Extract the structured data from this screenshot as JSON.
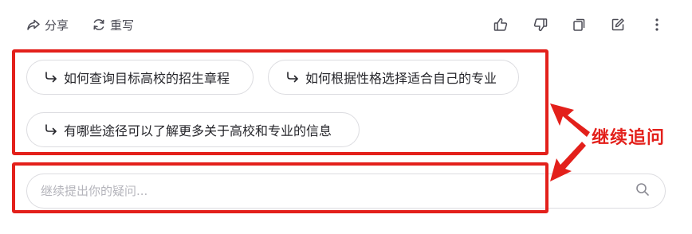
{
  "actions": {
    "share_label": "分享",
    "rewrite_label": "重写"
  },
  "toolbar_icons": [
    "thumbs-up-icon",
    "thumbs-down-icon",
    "copy-icon",
    "edit-icon",
    "more-vertical-icon"
  ],
  "suggestions": [
    {
      "label": "如何查询目标高校的招生章程"
    },
    {
      "label": "如何根据性格选择适合自己的专业"
    },
    {
      "label": "有哪些途径可以了解更多关于高校和专业的信息"
    }
  ],
  "input": {
    "placeholder": "继续提出你的疑问..."
  },
  "annotation": {
    "label": "继续追问",
    "color": "#e3201b"
  }
}
